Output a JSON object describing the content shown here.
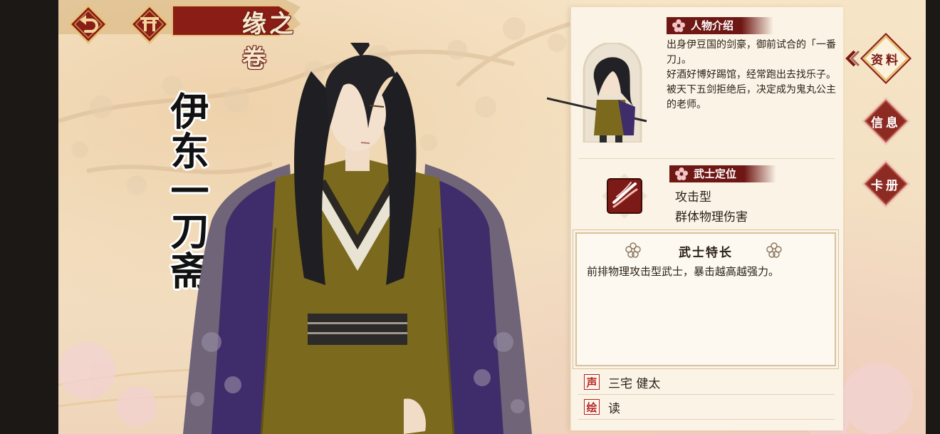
{
  "header": {
    "title": "缘之卷",
    "back_icon": "back-arrow-icon",
    "home_icon": "shrine-gate-icon"
  },
  "character": {
    "name": "伊东一刀斋"
  },
  "intro": {
    "label": "人物介绍",
    "lines": [
      "出身伊豆国的剑豪，御前试合的「一番刀」。",
      "好酒好博好踢馆，经常跑出去找乐子。",
      "被天下五剑拒绝后，决定成为鬼丸公主的老师。"
    ]
  },
  "role": {
    "label": "武士定位",
    "icon": "slash-attack-icon",
    "type": "攻击型",
    "damage": "群体物理伤害"
  },
  "specialty": {
    "title": "武士特长",
    "text": "前排物理攻击型武士，暴击越高越强力。"
  },
  "credits": {
    "voice_seal": "声",
    "voice": "三宅 健太",
    "art_seal": "绘",
    "art": "读"
  },
  "tabs": [
    {
      "label": "资料",
      "active": true
    },
    {
      "label": "信息",
      "active": false
    },
    {
      "label": "卡册",
      "active": false
    }
  ],
  "colors": {
    "accent": "#7a1813",
    "panel": "#fbf4e6",
    "background": "#f5e2c4"
  }
}
